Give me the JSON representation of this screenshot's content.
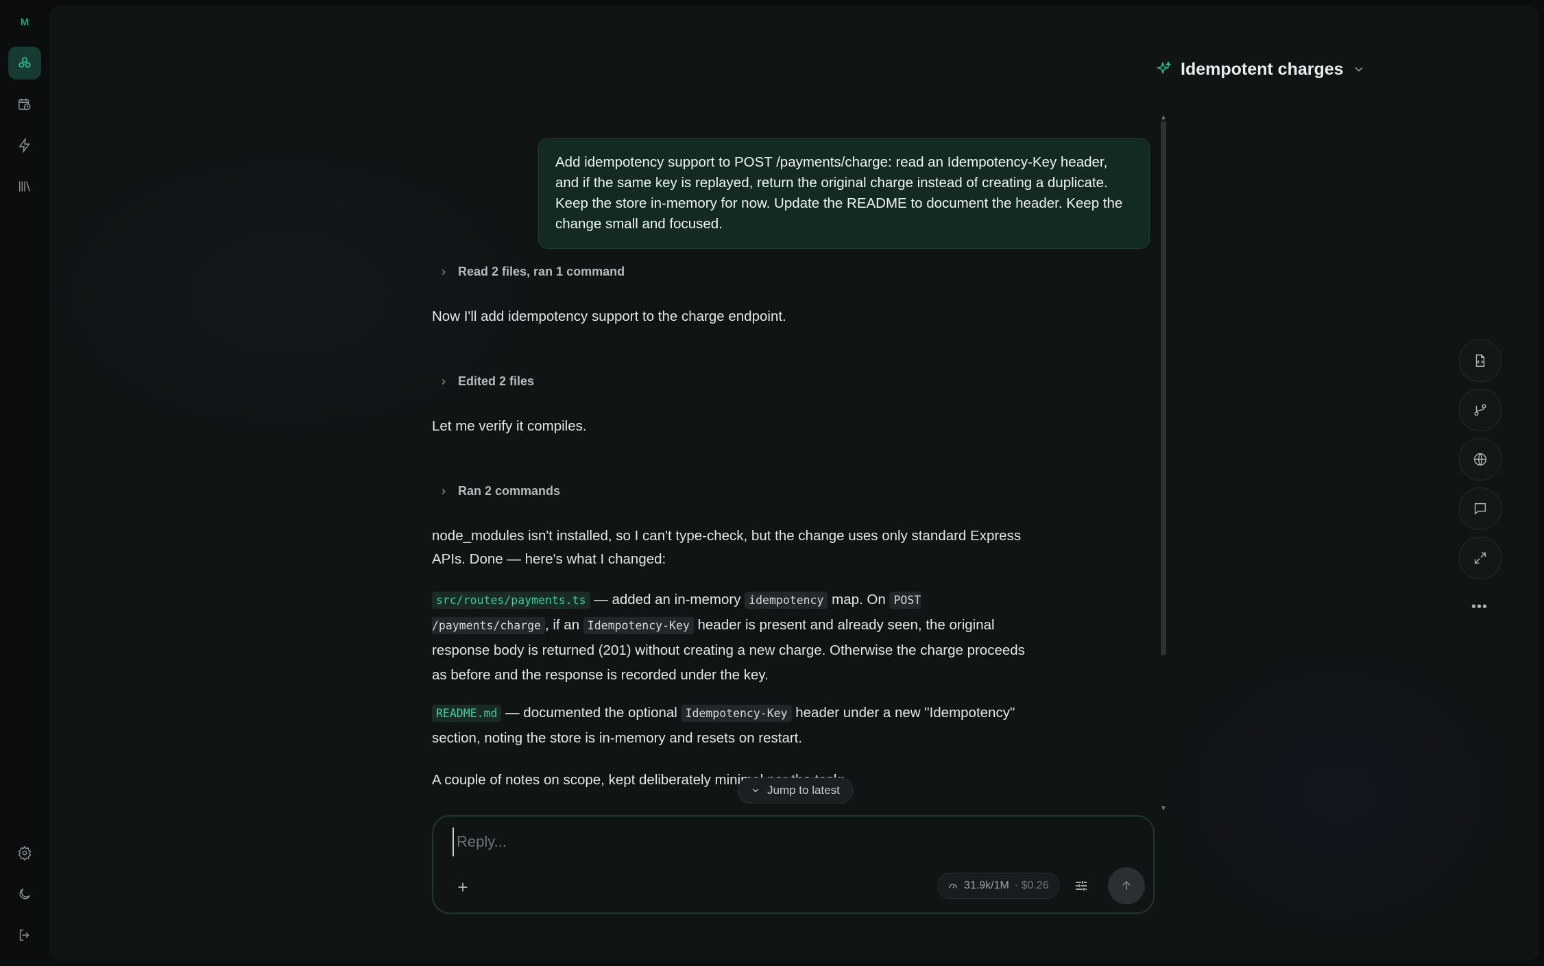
{
  "app": {
    "logo_letter": "M"
  },
  "rail": {
    "items": [
      {
        "name": "agents",
        "icon": "agents-icon",
        "active": true
      },
      {
        "name": "schedule",
        "icon": "calendar-clock-icon"
      },
      {
        "name": "automations",
        "icon": "lightning-icon"
      },
      {
        "name": "library",
        "icon": "library-icon"
      }
    ],
    "bottom": [
      {
        "name": "settings",
        "icon": "gear-icon"
      },
      {
        "name": "theme",
        "icon": "moon-icon"
      },
      {
        "name": "logout",
        "icon": "logout-icon"
      }
    ]
  },
  "header": {
    "title": "Idempotent charges"
  },
  "conversation": {
    "user_message": "Add idempotency support to POST /payments/charge: read an Idempotency-Key header, and if the same key is replayed, return the original charge instead of creating a duplicate. Keep the store in-memory for now. Update the README to document the header. Keep the change small and focused.",
    "activity_1": "Read 2 files, ran 1 command",
    "reply_1": "Now I'll add idempotency support to the charge endpoint.",
    "activity_2": "Edited 2 files",
    "reply_2": "Let me verify it compiles.",
    "activity_3": "Ran 2 commands",
    "reply_3": "node_modules isn't installed, so I can't type-check, but the change uses only standard Express APIs. Done — here's what I changed:",
    "change_1": {
      "file": "src/routes/payments.ts",
      "t1": " — added an in-memory ",
      "c1": "idempotency",
      "t2": " map. On ",
      "c2": "POST /payments/charge",
      "t3": ", if an ",
      "c3": "Idempotency-Key",
      "t4": " header is present and already seen, the original response body is returned (201) without creating a new charge. Otherwise the charge proceeds as before and the response is recorded under the key."
    },
    "change_2": {
      "file": "README.md",
      "t1": " — documented the optional ",
      "c1": "Idempotency-Key",
      "t2": " header under a new \"Idempotency\" section, noting the store is in-memory and resets on restart."
    },
    "notes_intro": "A couple of notes on scope, kept deliberately minimal per the task:",
    "jump_label": "Jump to latest"
  },
  "composer": {
    "placeholder": "Reply...",
    "value": "",
    "usage": "31.9k/1M",
    "cost": "· $0.26"
  },
  "side_tools": [
    {
      "name": "file-code",
      "icon": "file-code-icon"
    },
    {
      "name": "git-branch",
      "icon": "git-branch-icon"
    },
    {
      "name": "browser",
      "icon": "globe-icon"
    },
    {
      "name": "chat",
      "icon": "chat-icon"
    },
    {
      "name": "expand",
      "icon": "expand-icon"
    }
  ],
  "colors": {
    "accent": "#2bd4a0",
    "user_bubble": "#132a24",
    "background": "#0b0d0e"
  }
}
